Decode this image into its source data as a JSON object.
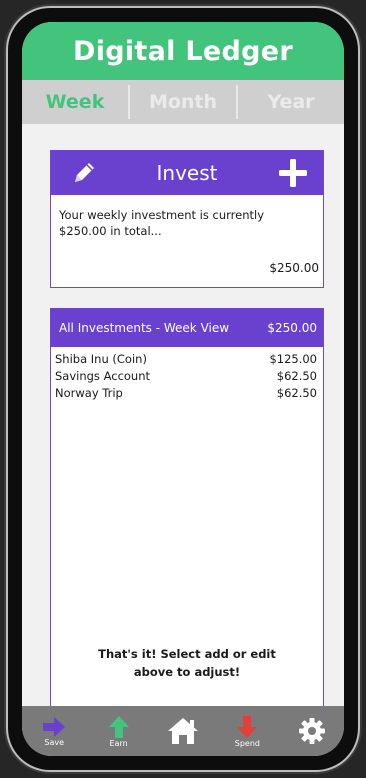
{
  "app": {
    "title": "Digital Ledger"
  },
  "tabs": [
    {
      "label": "Week",
      "active": true
    },
    {
      "label": "Month",
      "active": false
    },
    {
      "label": "Year",
      "active": false
    }
  ],
  "invest": {
    "title": "Invest",
    "message": "Your weekly investment is currently $250.00 in total...",
    "amount": "$250.00"
  },
  "investments": {
    "header_label": "All Investments - Week View",
    "header_total": "$250.00",
    "items": [
      {
        "name": "Shiba Inu (Coin)",
        "amount": "$125.00"
      },
      {
        "name": "Savings Account",
        "amount": "$62.50"
      },
      {
        "name": "Norway Trip",
        "amount": "$62.50"
      }
    ],
    "footer_note": "That's it! Select add or edit above to adjust!"
  },
  "nav": {
    "save_label": "Save",
    "earn_label": "Earn",
    "spend_label": "Spend"
  },
  "colors": {
    "brand_green": "#43c47d",
    "accent_purple": "#6a41cf",
    "spend_red": "#e0413a"
  }
}
